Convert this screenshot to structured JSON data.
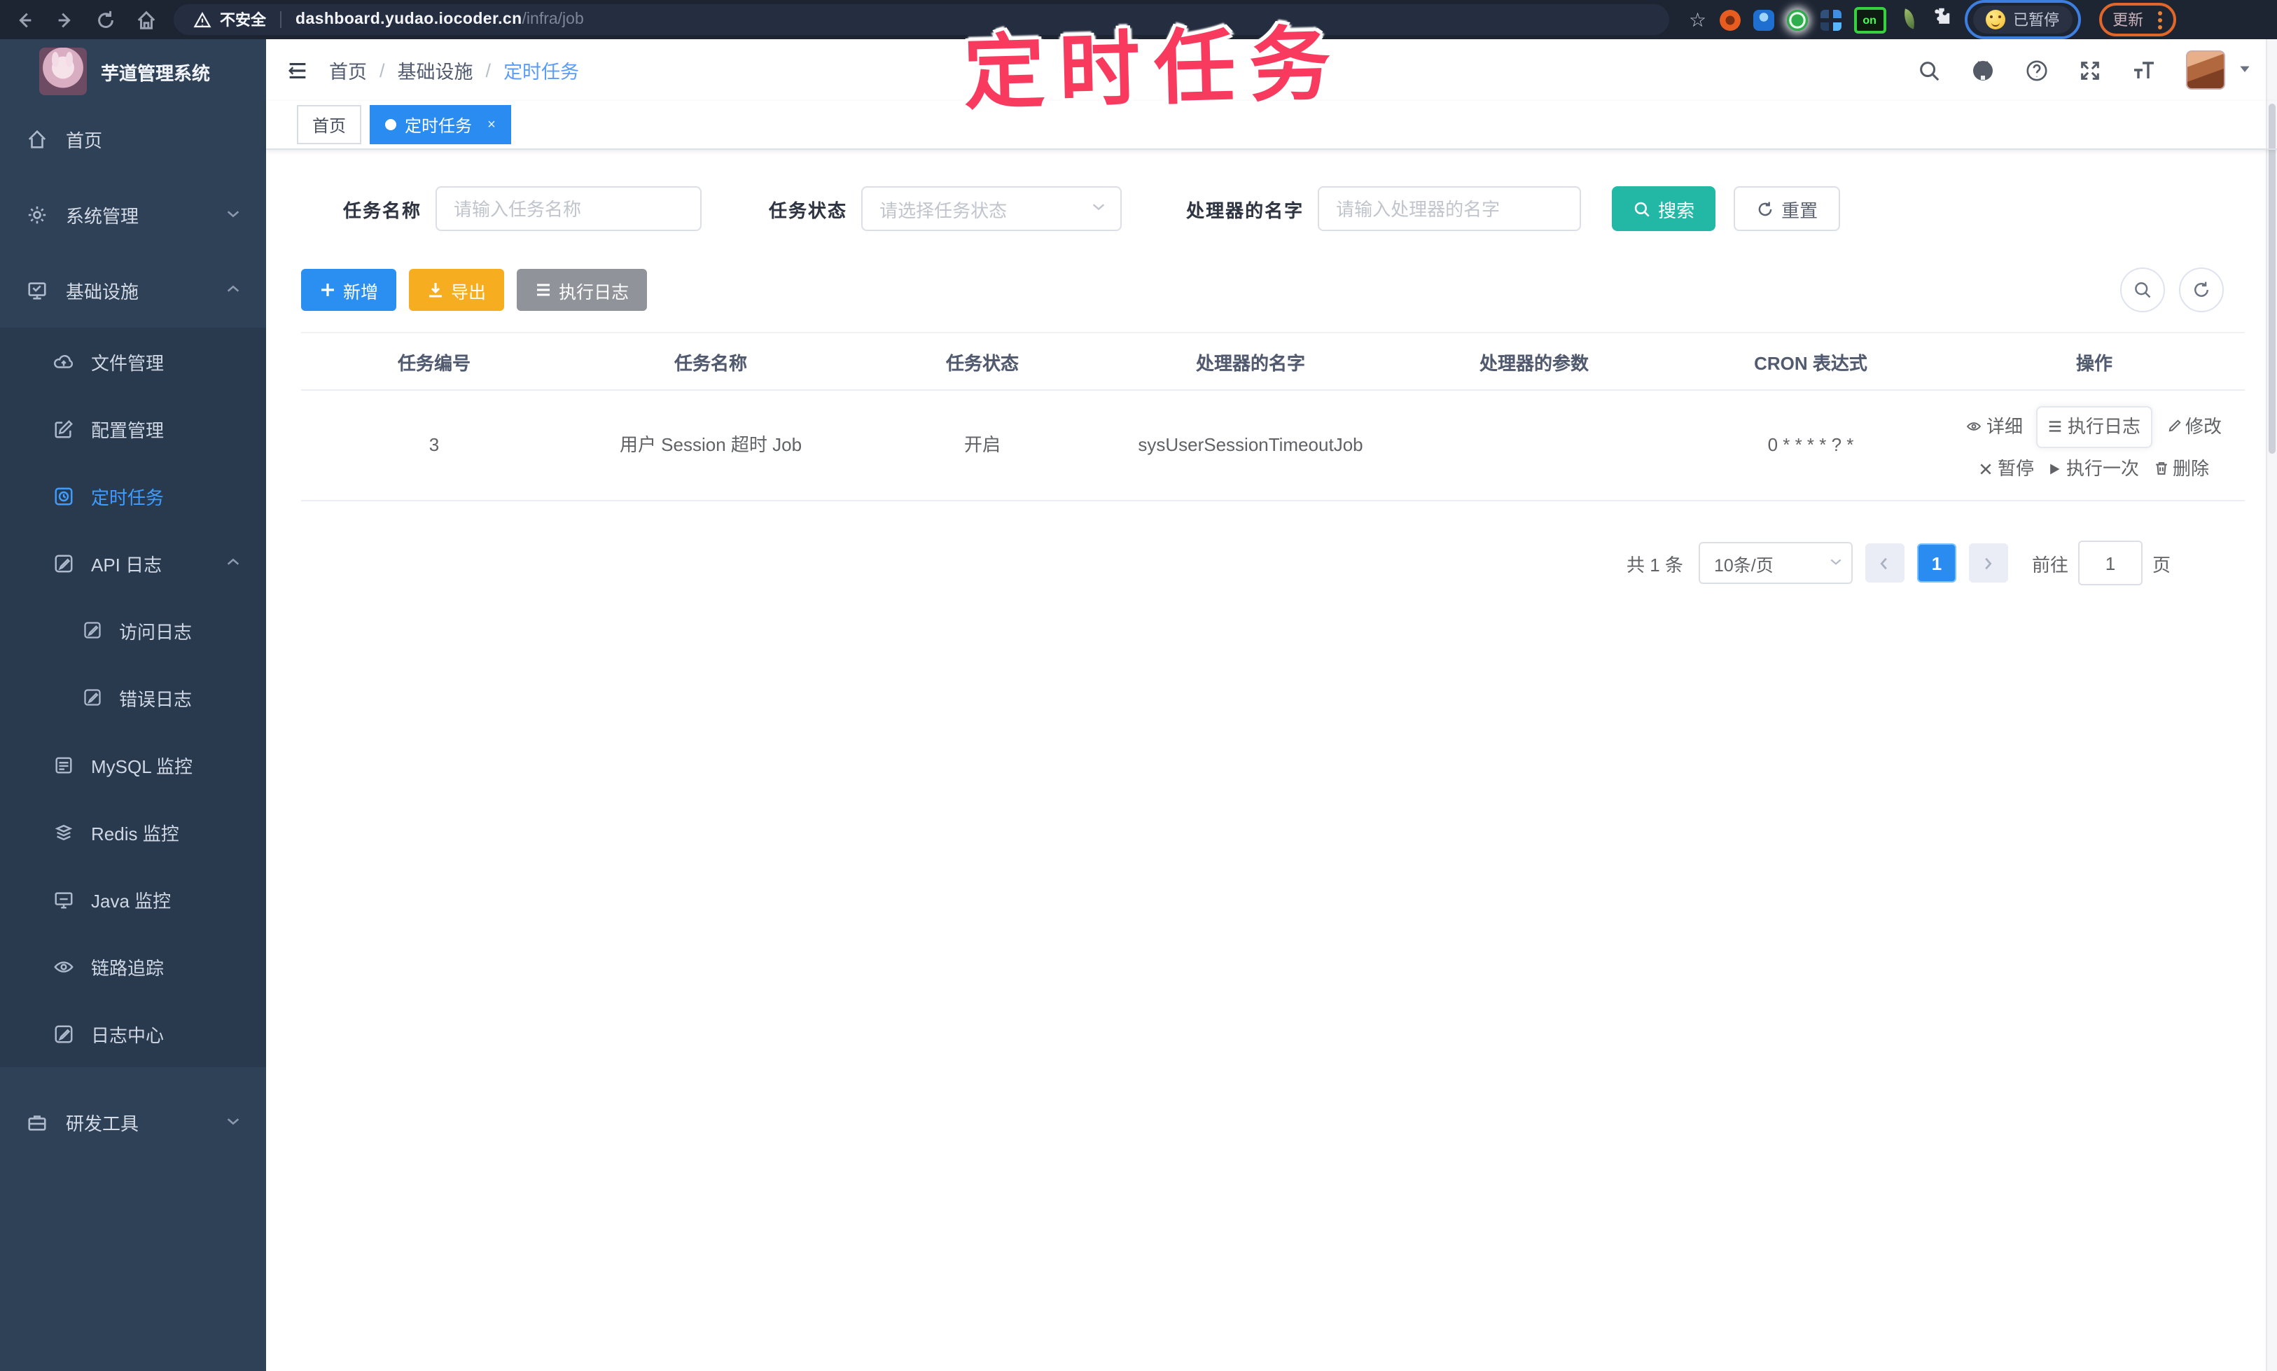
{
  "annotation": {
    "title": "定时任务"
  },
  "browser": {
    "security_label": "不安全",
    "url_host": "dashboard.yudao.iocoder.cn",
    "url_path": "/infra/job",
    "ext_on_label": "on",
    "paused_label": "已暂停",
    "update_label": "更新"
  },
  "sidebar": {
    "app_title": "芋道管理系统",
    "items": [
      {
        "label": "首页"
      },
      {
        "label": "系统管理"
      },
      {
        "label": "基础设施"
      },
      {
        "label": "文件管理"
      },
      {
        "label": "配置管理"
      },
      {
        "label": "定时任务"
      },
      {
        "label": "API 日志"
      },
      {
        "label": "访问日志"
      },
      {
        "label": "错误日志"
      },
      {
        "label": "MySQL 监控"
      },
      {
        "label": "Redis 监控"
      },
      {
        "label": "Java 监控"
      },
      {
        "label": "链路追踪"
      },
      {
        "label": "日志中心"
      },
      {
        "label": "研发工具"
      }
    ]
  },
  "breadcrumb": {
    "items": [
      "首页",
      "基础设施",
      "定时任务"
    ],
    "sep": "/"
  },
  "tabs": [
    {
      "label": "首页"
    },
    {
      "label": "定时任务",
      "close": "×"
    }
  ],
  "filter": {
    "name_label": "任务名称",
    "name_placeholder": "请输入任务名称",
    "status_label": "任务状态",
    "status_placeholder": "请选择任务状态",
    "handler_label": "处理器的名字",
    "handler_placeholder": "请输入处理器的名字",
    "search_label": "搜索",
    "reset_label": "重置"
  },
  "actions": {
    "add": "新增",
    "export": "导出",
    "exec_log": "执行日志"
  },
  "table": {
    "headers": [
      "任务编号",
      "任务名称",
      "任务状态",
      "处理器的名字",
      "处理器的参数",
      "CRON 表达式",
      "操作"
    ],
    "row": {
      "id": "3",
      "name": "用户 Session 超时 Job",
      "status": "开启",
      "handler": "sysUserSessionTimeoutJob",
      "param": "",
      "cron": "0 * * * * ? *",
      "ops": [
        "详细",
        "执行日志",
        "修改",
        "暂停",
        "执行一次",
        "删除"
      ]
    }
  },
  "pagination": {
    "total": "共 1 条",
    "page_size": "10条/页",
    "page": "1",
    "goto_label": "前往",
    "goto_value": "1",
    "unit_label": "页"
  },
  "colors": {
    "primary": "#409eff",
    "teal": "#23b8a6",
    "warning": "#f6ad20",
    "info": "#909399",
    "annotation_pink": "#f93a5f",
    "sidebar_bg": "#2f4156"
  }
}
